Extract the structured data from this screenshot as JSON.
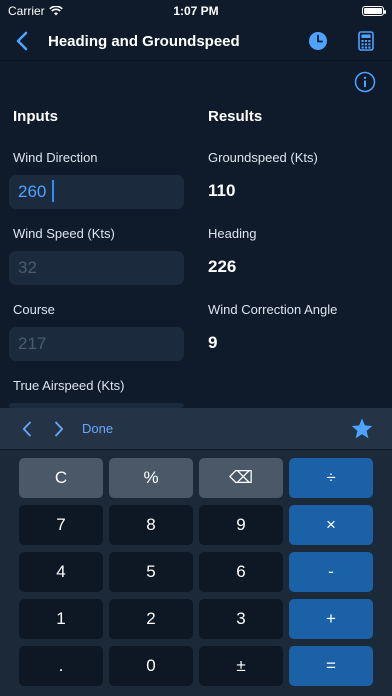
{
  "status_bar": {
    "carrier": "Carrier",
    "time": "1:07 PM"
  },
  "nav": {
    "title": "Heading and Groundspeed",
    "icons": [
      "chevron-left-icon",
      "clock-icon",
      "calculator-icon"
    ]
  },
  "inputs": {
    "title": "Inputs",
    "wind_direction": {
      "label": "Wind Direction",
      "value": "260"
    },
    "wind_speed": {
      "label": "Wind Speed (Kts)",
      "placeholder": "32"
    },
    "course": {
      "label": "Course",
      "placeholder": "217"
    },
    "true_airspeed": {
      "label": "True Airspeed (Kts)"
    }
  },
  "results": {
    "title": "Results",
    "groundspeed": {
      "label": "Groundspeed (Kts)",
      "value": "110"
    },
    "heading": {
      "label": "Heading",
      "value": "226"
    },
    "wind_correction": {
      "label": "Wind Correction Angle",
      "value": "9"
    }
  },
  "keyboard": {
    "toolbar": {
      "done": "Done"
    },
    "keys": {
      "clear": "C",
      "percent": "%",
      "backspace": "⌫",
      "divide": "÷",
      "seven": "7",
      "eight": "8",
      "nine": "9",
      "multiply": "×",
      "four": "4",
      "five": "5",
      "six": "6",
      "minus": "-",
      "one": "1",
      "two": "2",
      "three": "3",
      "plus": "+",
      "decimal": ".",
      "zero": "0",
      "plus_minus": "±",
      "equals": "="
    }
  },
  "colors": {
    "background": "#0f1b2b",
    "accent": "#4da3ff",
    "operator_key": "#1a61a8",
    "function_key": "#4a5868"
  }
}
